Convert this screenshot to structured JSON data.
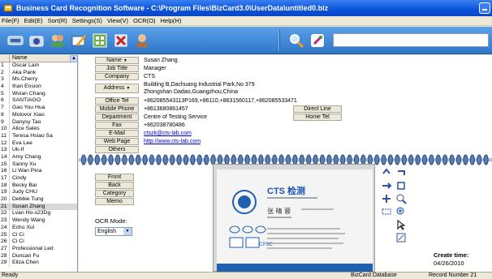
{
  "window": {
    "title": "Business Card Recognition Software - C:\\Program Files\\BizCard3.0\\UserData\\untitled0.biz"
  },
  "menu": [
    "File(F)",
    "Edit(E)",
    "Sort(R)",
    "Settings(S)",
    "View(V)",
    "OCR(O)",
    "Help(H)"
  ],
  "list": {
    "header": "Name",
    "rows": [
      {
        "n": "1",
        "name": "Oscar Lam"
      },
      {
        "n": "2",
        "name": "Aka Pank"
      },
      {
        "n": "3",
        "name": "Ms.Cherry"
      },
      {
        "n": "4",
        "name": "Ihan Ension"
      },
      {
        "n": "5",
        "name": "Wvian Chang"
      },
      {
        "n": "6",
        "name": "SANTIAGO"
      },
      {
        "n": "7",
        "name": "Gao You Hua"
      },
      {
        "n": "8",
        "name": "Molovor Xiao"
      },
      {
        "n": "9",
        "name": "Danysy Tao"
      },
      {
        "n": "10",
        "name": "Alice Sales"
      },
      {
        "n": "11",
        "name": "Teresa Hsiao Sa"
      },
      {
        "n": "12",
        "name": "Eva Lee"
      },
      {
        "n": "13",
        "name": "Uk-If"
      },
      {
        "n": "14",
        "name": "Amy Chang"
      },
      {
        "n": "15",
        "name": "Sanny Xu"
      },
      {
        "n": "16",
        "name": "Li Wan Pina"
      },
      {
        "n": "17",
        "name": "Cindy"
      },
      {
        "n": "18",
        "name": "Becky Bai"
      },
      {
        "n": "19",
        "name": "Judy CHU"
      },
      {
        "n": "20",
        "name": "Debbie Tung"
      },
      {
        "n": "21",
        "name": "Susan Zhang"
      },
      {
        "n": "22",
        "name": "Lvan Ho-x23Dg"
      },
      {
        "n": "23",
        "name": "Wendy Wang"
      },
      {
        "n": "24",
        "name": "Echo Xul"
      },
      {
        "n": "25",
        "name": "Ci Ci"
      },
      {
        "n": "26",
        "name": "Ci Ci"
      },
      {
        "n": "27",
        "name": "Professional Led"
      },
      {
        "n": "28",
        "name": "Duncan Fu"
      },
      {
        "n": "29",
        "name": "Eliza Chen"
      }
    ]
  },
  "fields": {
    "name_label": "Name",
    "name_value": "Susan Zhang",
    "jobtitle_label": "Job Title",
    "jobtitle_value": "Manager",
    "company_label": "Company",
    "company_value": "CTS",
    "address_label": "Address",
    "address_line1": "Building B,Dachuang Industrial Park,No 379",
    "address_line2": "Zhongshan Dadao,Guangzhou,China",
    "officetel_label": "Office Tel",
    "officetel_value": "+862085543113P169,+86110,+8631560117,+862085533471",
    "mobile_label": "Mobile Phone",
    "mobile_value": "+8613680861457",
    "direct_line": "Direct Line",
    "department_label": "Department",
    "department_value": "Centre of Testing Service",
    "home_tel": "Home Tel",
    "fax_label": "Fax",
    "fax_value": "+862038780486",
    "email_label": "E-Mail",
    "email_value": "ctszk@cts-lab.com",
    "webpage_label": "Web Page",
    "webpage_value": "http://www.cts-lab.com",
    "others_label": "Others"
  },
  "side_buttons": [
    "Front",
    "Back",
    "Category",
    "Memo"
  ],
  "ocr": {
    "label": "OCR Mode:",
    "value": "English"
  },
  "card": {
    "brand": "CTS 检测",
    "person": "张 晴 蓉",
    "logos": [
      "CPSC"
    ]
  },
  "create": {
    "label": "Create time:",
    "date": "04/26/2010"
  },
  "status": {
    "left": "Ready",
    "db": "BizCard Database",
    "record": "Record Number 21"
  }
}
